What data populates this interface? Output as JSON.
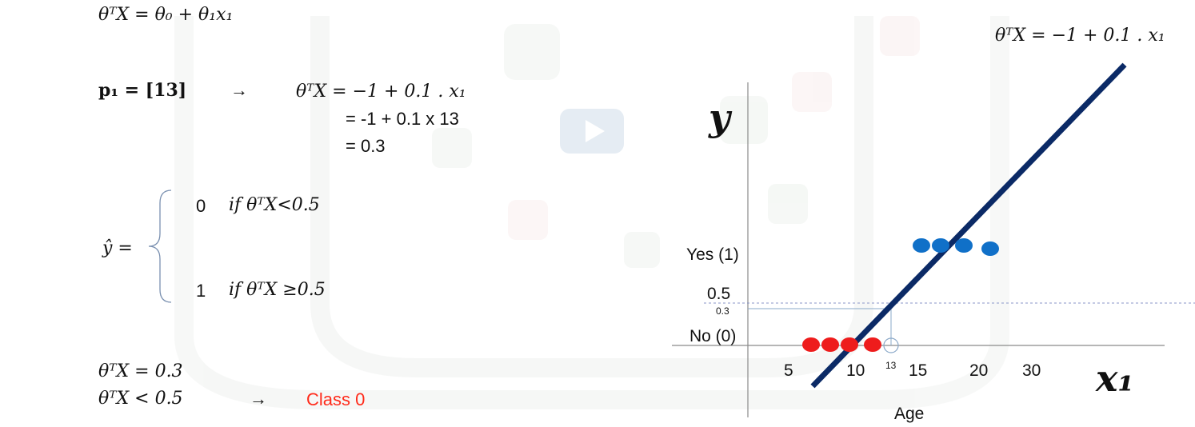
{
  "equations": {
    "general": "θᵀX = θ₀ + θ₁x₁",
    "p1_label": "p₁ = [13]",
    "arrow": "→",
    "step1": "θᵀX = −1 + 0.1 . x₁",
    "step2": "= -1 + 0.1 x 13",
    "step3": "= 0.3",
    "yhat": "ŷ =",
    "case0_value": "0",
    "case0_cond": "if θᵀX<0.5",
    "case1_value": "1",
    "case1_cond": "if θᵀX ≥0.5",
    "result_line1": "θᵀX = 0.3",
    "result_line2": "θᵀX  <  0.5",
    "result_arrow": "→",
    "result_class": "Class 0"
  },
  "colors": {
    "line": "#0b2a66",
    "red_points": "#ee1c1c",
    "blue_points": "#1070c8",
    "class_text": "#ff2a1a"
  },
  "chart_data": {
    "type": "scatter",
    "title": "θᵀX = −1 + 0.1 . x₁",
    "xlabel": "Age",
    "x_symbol": "x₁",
    "y_symbol": "y",
    "x_ticks": [
      "5",
      "10",
      "15",
      "20",
      "30"
    ],
    "y_ticks": [
      "No (0)",
      "0.3",
      "0.5",
      "Yes (1)"
    ],
    "marker_label": "13",
    "marker_x": 13,
    "marker_y": 0.3,
    "threshold": 0.5,
    "series": [
      {
        "color": "#ee1c1c",
        "x": [
          6,
          8,
          10,
          12
        ],
        "y": [
          0,
          0,
          0,
          0
        ]
      },
      {
        "color": "#1070c8",
        "x": [
          14,
          16,
          18,
          21
        ],
        "y": [
          1,
          1,
          1,
          1
        ]
      }
    ],
    "line": {
      "intercept": -1,
      "slope": 0.1
    },
    "grid": false
  }
}
